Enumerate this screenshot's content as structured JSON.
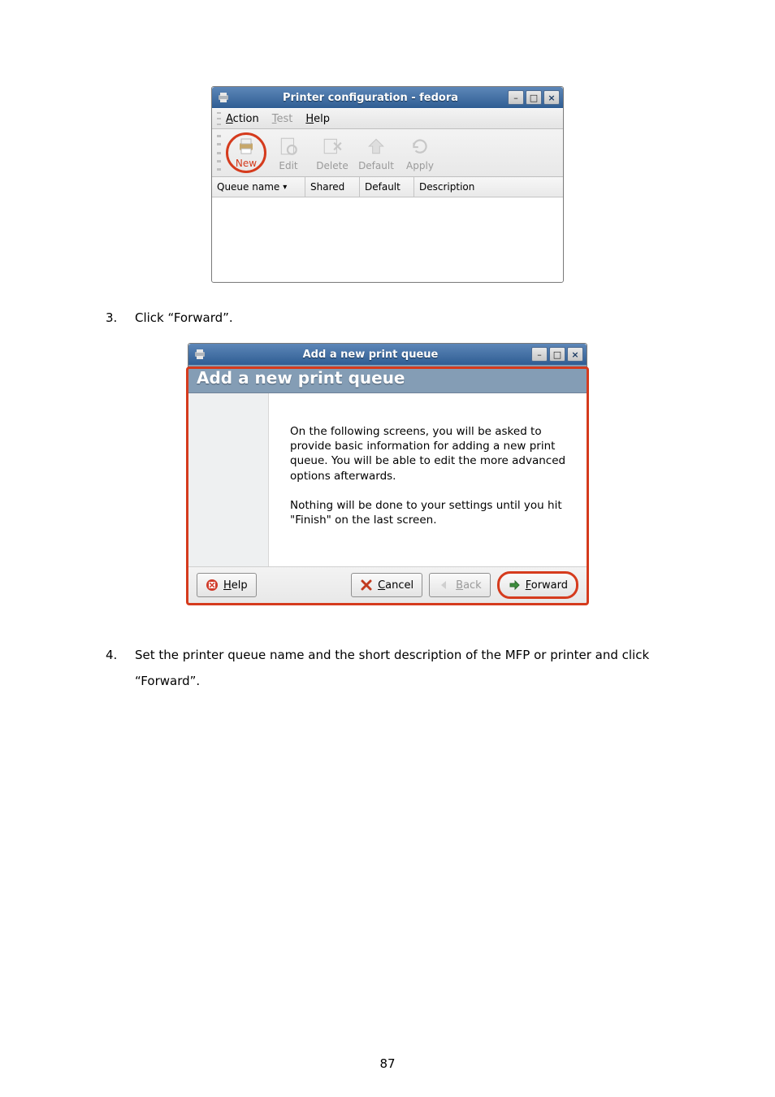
{
  "win1": {
    "title": "Printer configuration - fedora",
    "menus": {
      "action_pre": "A",
      "action_post": "ction",
      "test_pre": "T",
      "test_post": "est",
      "help_pre": "H",
      "help_post": "elp"
    },
    "tools": {
      "new": "New",
      "edit": "Edit",
      "delete": "Delete",
      "default": "Default",
      "apply": "Apply"
    },
    "columns": {
      "queue": "Queue name",
      "shared": "Shared",
      "default": "Default",
      "desc": "Description"
    }
  },
  "step3": {
    "num": "3.",
    "text": "Click “Forward”."
  },
  "win2": {
    "title": "Add a new print queue",
    "banner": "Add a new print queue",
    "para1": "On the following screens, you will be asked to provide basic information for adding a new print queue.  You will be able to edit the more advanced options afterwards.",
    "para2": "Nothing will be done to your settings until you hit \"Finish\" on the last screen.",
    "buttons": {
      "help_pre": "H",
      "help_post": "elp",
      "cancel_pre": "C",
      "cancel_post": "ancel",
      "back_pre": "B",
      "back_post": "ack",
      "forward_pre": "F",
      "forward_post": "orward"
    }
  },
  "step4": {
    "num": "4.",
    "text": "Set the printer queue name and the short description of the MFP or printer and click “Forward”."
  },
  "page_num": "87"
}
